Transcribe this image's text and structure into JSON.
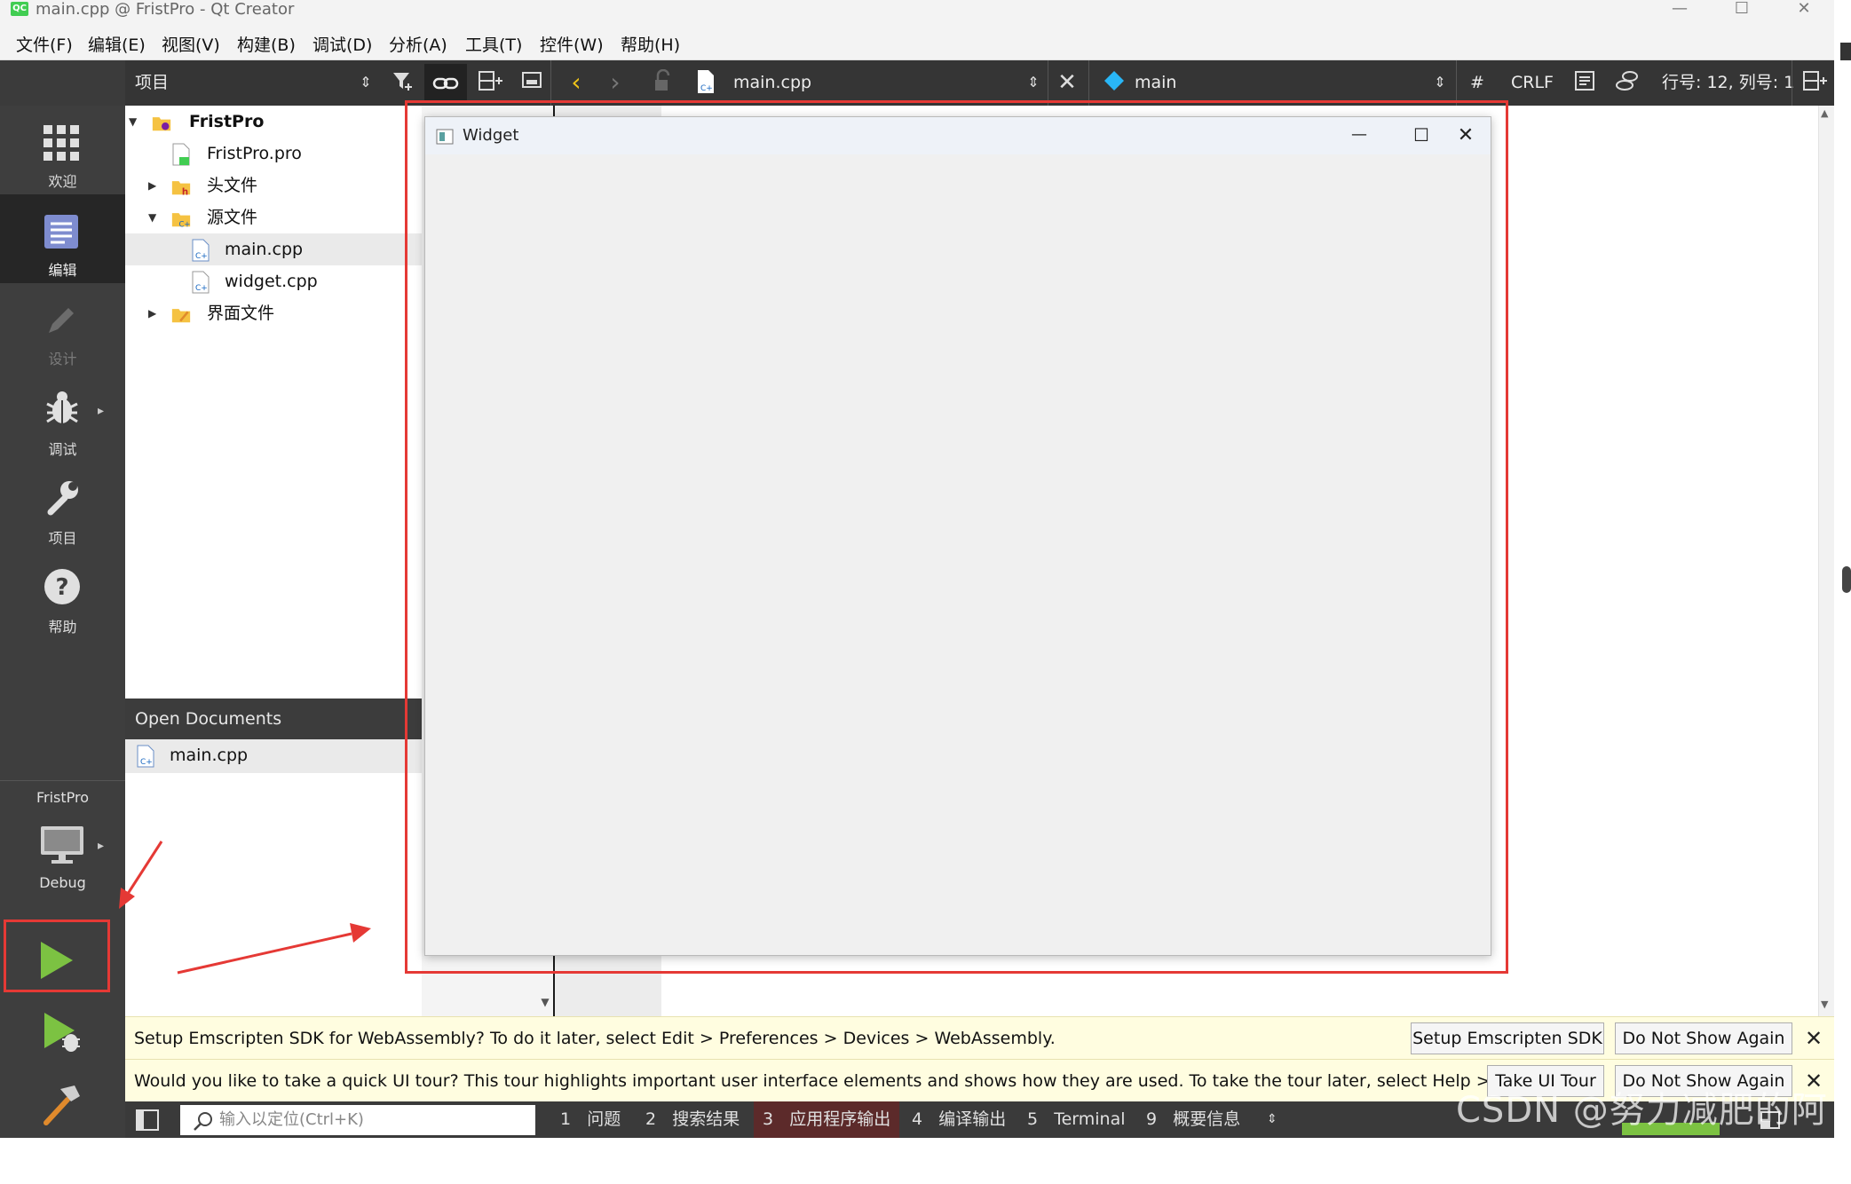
{
  "window": {
    "title": "main.cpp @ FristPro - Qt Creator",
    "logo": "QC"
  },
  "menu": [
    "文件(F)",
    "编辑(E)",
    "视图(V)",
    "构建(B)",
    "调试(D)",
    "分析(A)",
    "工具(T)",
    "控件(W)",
    "帮助(H)"
  ],
  "toolbar": {
    "panel_title": "项目",
    "file_name": "main.cpp",
    "symbol": "main",
    "hash": "#",
    "line_ending": "CRLF",
    "position": "行号: 12, 列号: 1"
  },
  "modes": {
    "welcome": "欢迎",
    "edit": "编辑",
    "design": "设计",
    "debug": "调试",
    "projects": "项目",
    "help": "帮助",
    "kit_project": "FristPro",
    "kit_build": "Debug"
  },
  "tree": {
    "root": "FristPro",
    "pro": "FristPro.pro",
    "headers": "头文件",
    "sources": "源文件",
    "main": "main.cpp",
    "widget": "widget.cpp",
    "forms": "界面文件"
  },
  "open_docs": {
    "title": "Open Documents",
    "item": "main.cpp"
  },
  "widget_window": {
    "title": "Widget"
  },
  "infobars": {
    "emscripten": {
      "text": "Setup Emscripten SDK for WebAssembly? To do it later, select Edit > Preferences > Devices > WebAssembly.",
      "primary": "Setup Emscripten SDK",
      "secondary": "Do Not Show Again"
    },
    "tour": {
      "text": "Would you like to take a quick UI tour? This tour highlights important user interface elements and shows how they are used. To take the tour later, select Help > UI Tour.",
      "primary": "Take UI Tour",
      "secondary": "Do Not Show Again"
    }
  },
  "status": {
    "locator_placeholder": "输入以定位(Ctrl+K)",
    "panes": [
      {
        "num": "1",
        "label": "问题"
      },
      {
        "num": "2",
        "label": "搜索结果"
      },
      {
        "num": "3",
        "label": "应用程序输出"
      },
      {
        "num": "4",
        "label": "编译输出"
      },
      {
        "num": "5",
        "label": "Terminal"
      },
      {
        "num": "9",
        "label": "概要信息"
      }
    ]
  },
  "watermark": "CSDN @努力减肥的阿源",
  "colors": {
    "highlight": "#e53935",
    "run_green": "#7cc242",
    "toolbar_bg": "#353535",
    "modebar_bg": "#3e3e3e"
  }
}
